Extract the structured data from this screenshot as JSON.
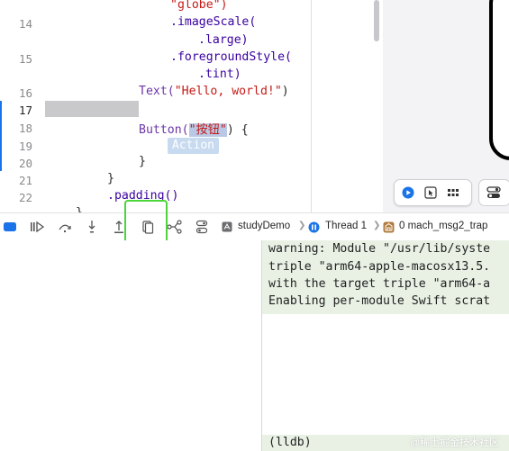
{
  "editor": {
    "line_numbers": [
      "14",
      "15",
      "16",
      "17",
      "18",
      "19",
      "20",
      "21",
      "22"
    ],
    "current_line": "17",
    "code": {
      "l0_str": "\"globe\")",
      "l1_fn": ".imageScale(",
      "l2_fn": ".large)",
      "l3_fn": ".foregroundStyle(",
      "l4_fn": ".tint)",
      "l5_pre": "Text(",
      "l5_str": "\"Hello, world!\"",
      "l5_post": ")",
      "l7_pre": "Button(",
      "l7_str": "\"按钮\"",
      "l7_post": ") {",
      "l8_tag": "Action",
      "l9": "}",
      "l10": "}",
      "l11": ".padding()",
      "l12": "}"
    }
  },
  "debug_bar": {
    "breadcrumb": {
      "project": "studyDemo",
      "thread": "Thread 1",
      "frame": "0 mach_msg2_trap"
    }
  },
  "console": {
    "lines": [
      "warning: Module \"/usr/lib/syste",
      "triple \"arm64-apple-macosx13.5.",
      "with the target triple \"arm64-a",
      "Enabling per-module Swift scrat"
    ],
    "prompt": "(lldb)"
  },
  "watermark": "@稀土掘金技术社区",
  "colors": {
    "accent": "#1a73e8",
    "string": "#c41a16",
    "highlight_box": "#4cd63a",
    "console_bg": "#e9f1e5"
  }
}
